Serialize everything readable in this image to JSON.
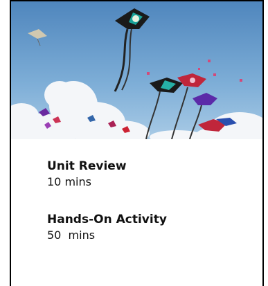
{
  "hero_image": {
    "icon": "kites-photo",
    "sky_color": "#6d9ec9"
  },
  "items": [
    {
      "title": "Unit Review",
      "duration": "10 mins"
    },
    {
      "title": "Hands-On Activity",
      "duration": "50  mins"
    }
  ]
}
